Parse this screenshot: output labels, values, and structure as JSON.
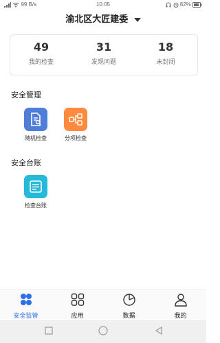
{
  "status_bar": {
    "left": "99 B/s",
    "time": "10:05",
    "battery": "82%"
  },
  "header": {
    "title": "渝北区大匠建委"
  },
  "stats": [
    {
      "value": "49",
      "label": "我的检查"
    },
    {
      "value": "31",
      "label": "发现问题"
    },
    {
      "value": "18",
      "label": "未封闭"
    }
  ],
  "sections": {
    "safety_management": {
      "title": "安全管理",
      "items": [
        {
          "label": "随机检查",
          "icon": "document-search-icon",
          "color": "#4f7ed9"
        },
        {
          "label": "分项检查",
          "icon": "branch-icon",
          "color": "#ff8a3d"
        }
      ]
    },
    "safety_ledger": {
      "title": "安全台账",
      "items": [
        {
          "label": "检查台账",
          "icon": "ledger-icon",
          "color": "#26b9d9"
        }
      ]
    }
  },
  "bottom_nav": [
    {
      "label": "安全监管",
      "icon": "grid-dots-icon",
      "active": true
    },
    {
      "label": "应用",
      "icon": "apps-icon",
      "active": false
    },
    {
      "label": "数据",
      "icon": "pie-chart-icon",
      "active": false
    },
    {
      "label": "我的",
      "icon": "person-icon",
      "active": false
    }
  ],
  "colors": {
    "accent": "#2f6fe8"
  }
}
